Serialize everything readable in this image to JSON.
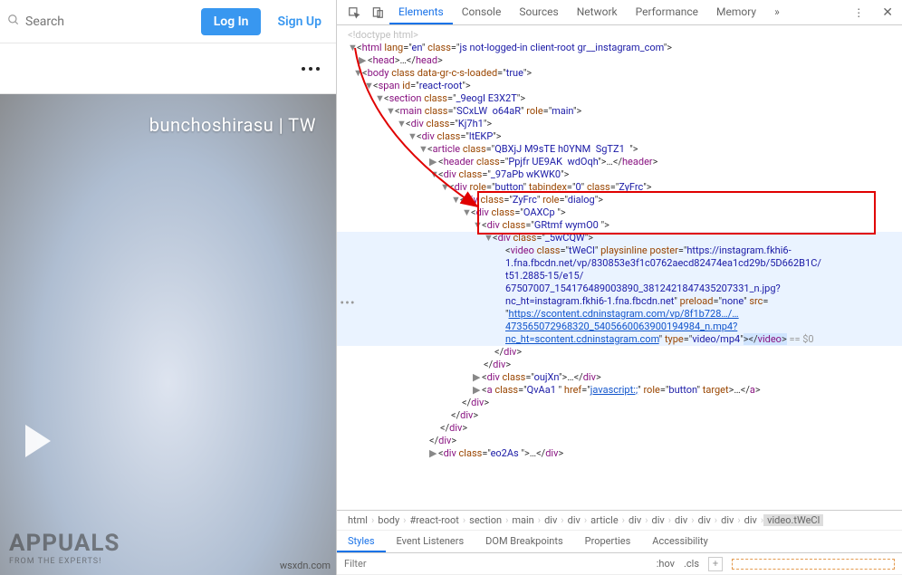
{
  "left": {
    "search_placeholder": "Search",
    "login_label": "Log In",
    "signup_label": "Sign Up",
    "video_watermark": "bunchoshirasu | TW",
    "logo_main": "APPUALS",
    "logo_sub": "FROM THE EXPERTS!",
    "site_watermark": "wsxdn.com"
  },
  "devtools": {
    "tabs": [
      "Elements",
      "Console",
      "Sources",
      "Network",
      "Performance",
      "Memory"
    ],
    "active_tab": "Elements",
    "left_gutter": "•••",
    "dom_lines": [
      {
        "ind": 12,
        "html": "<span class='doctype'>&lt;!doctype html&gt;</span>"
      },
      {
        "ind": 12,
        "arrow": "▼",
        "html": "&lt;<span class='tag'>html</span> <span class='attr-n'>lang</span>=\"<span class='attr-v'>en</span>\" <span class='attr-n'>class</span>=\"<span class='attr-v'>js not-logged-in client-root gr__instagram_com</span>\"&gt;"
      },
      {
        "ind": 24,
        "arrow": "▶",
        "html": "&lt;<span class='tag'>head</span>&gt;…&lt;/<span class='tag'>head</span>&gt;"
      },
      {
        "ind": 18,
        "arrow": "▼",
        "html": "&lt;<span class='tag'>body</span> <span class='attr-n'>class</span> <span class='attr-n'>data-gr-c-s-loaded</span>=\"<span class='attr-v'>true</span>\"&gt;"
      },
      {
        "ind": 30,
        "arrow": "▼",
        "html": "&lt;<span class='tag'>span</span> <span class='attr-n'>id</span>=\"<span class='attr-v'>react-root</span>\"&gt;"
      },
      {
        "ind": 42,
        "arrow": "▼",
        "html": "&lt;<span class='tag'>section</span> <span class='attr-n'>class</span>=\"<span class='attr-v'>_9eogI E3X2T</span>\"&gt;"
      },
      {
        "ind": 54,
        "arrow": "▼",
        "html": "&lt;<span class='tag'>main</span> <span class='attr-n'>class</span>=\"<span class='attr-v'>SCxLW&nbsp;&nbsp;o64aR</span>\" <span class='attr-n'>role</span>=\"<span class='attr-v'>main</span>\"&gt;"
      },
      {
        "ind": 66,
        "arrow": "▼",
        "html": "&lt;<span class='tag'>div</span> <span class='attr-n'>class</span>=\"<span class='attr-v'>Kj7h1</span>\"&gt;"
      },
      {
        "ind": 78,
        "arrow": "▼",
        "html": "&lt;<span class='tag'>div</span> <span class='attr-n'>class</span>=\"<span class='attr-v'>ltEKP</span>\"&gt;"
      },
      {
        "ind": 90,
        "arrow": "▼",
        "html": "&lt;<span class='tag'>article</span> <span class='attr-n'>class</span>=\"<span class='attr-v'>QBXjJ M9sTE h0YNM&nbsp;&nbsp;SgTZ1&nbsp;&nbsp;</span>\"&gt;"
      },
      {
        "ind": 102,
        "arrow": "▶",
        "html": "&lt;<span class='tag'>header</span> <span class='attr-n'>class</span>=\"<span class='attr-v'>Ppjfr UE9AK&nbsp;&nbsp;wdOqh</span>\"&gt;…&lt;/<span class='tag'>header</span>&gt;"
      },
      {
        "ind": 102,
        "arrow": "▼",
        "html": "&lt;<span class='tag'>div</span> <span class='attr-n'>class</span>=\"<span class='attr-v'>_97aPb wKWK0</span>\"&gt;"
      },
      {
        "ind": 114,
        "arrow": "▼",
        "html": "&lt;<span class='tag'>div</span> <span class='attr-n'>role</span>=\"<span class='attr-v'>button</span>\" <span class='attr-n'>tabindex</span>=\"<span class='attr-v'>0</span>\" <span class='attr-n'>class</span>=\"<span class='attr-v'>ZyFrc</span>\"&gt;"
      },
      {
        "ind": 126,
        "arrow": "▼",
        "html": "&lt;<span class='tag'>div</span> <span class='attr-n'>class</span>=\"<span class='attr-v'>ZyFrc</span>\" <span class='attr-n'>role</span>=\"<span class='attr-v'>dialog</span>\"&gt;"
      },
      {
        "ind": 138,
        "arrow": "▼",
        "html": "&lt;<span class='tag'>div</span> <span class='attr-n'>class</span>=\"<span class='attr-v'>OAXCp </span>\"&gt;"
      },
      {
        "ind": 150,
        "arrow": "▼",
        "html": "&lt;<span class='tag'>div</span> <span class='attr-n'>class</span>=\"<span class='attr-v'>GRtmf wymO0 </span>\"&gt;"
      },
      {
        "ind": 162,
        "arrow": "▼",
        "html": "&lt;<span class='tag'>div</span> <span class='attr-n'>class</span>=\"<span class='attr-v'>_5wCQW</span>\"&gt;",
        "sel": true
      },
      {
        "ind": 186,
        "html": "&lt;<span class='tag'>video</span> <span class='attr-n'>class</span>=\"<span class='attr-v'>tWeCl</span>\" <span class='attr-n'>playsinline</span> <span class='attr-n'>poster</span>=\"<span class='attr-v'>https://instagram.fkhi6-</span>",
        "sel": true
      },
      {
        "ind": 186,
        "html": "<span class='attr-v'>1.fna.fbcdn.net/vp/830853e3f1c0762aecd82474ea1cd29b/5D662B1C/</span>",
        "sel": true
      },
      {
        "ind": 186,
        "html": "<span class='attr-v'>t51.2885-15/e15/</span>",
        "sel": true
      },
      {
        "ind": 186,
        "html": "<span class='attr-v'>67507007_154176489003890_3812421847435207331_n.jpg?</span>",
        "sel": true
      },
      {
        "ind": 186,
        "html": "<span class='attr-v'>nc_ht=instagram.fkhi6-1.fna.fbcdn.net</span>\" <span class='attr-n'>preload</span>=\"<span class='attr-v'>none</span>\" <span class='attr-n'>src</span>=",
        "sel": true
      },
      {
        "ind": 186,
        "html": "\"<a class='url-link'>https://scontent.cdninstagram.com/vp/8f1b728…/…</a>",
        "sel": true
      },
      {
        "ind": 186,
        "html": "<a class='url-link'>473565072968320_5405660063900194984_n.mp4?</a>",
        "sel": true
      },
      {
        "ind": 186,
        "html": "<a class='url-link'>nc_ht=scontent.cdninstagram.com</a>\" <span class='attr-n'>type</span>=\"<span class='attr-v'>video/mp4</span>\"<span style='background:#d0e4ff'>&gt;&lt;/<span class='tag'>video</span>&gt;</span> <span class='eqline'>== $0</span>",
        "sel": true
      },
      {
        "ind": 174,
        "html": "&lt;/<span class='tag'>div</span>&gt;"
      },
      {
        "ind": 162,
        "html": "&lt;/<span class='tag'>div</span>&gt;"
      },
      {
        "ind": 150,
        "arrow": "▶",
        "html": "&lt;<span class='tag'>div</span> <span class='attr-n'>class</span>=\"<span class='attr-v'>oujXn</span>\"&gt;…&lt;/<span class='tag'>div</span>&gt;"
      },
      {
        "ind": 150,
        "arrow": "▶",
        "html": "&lt;<span class='tag'>a</span> <span class='attr-n'>class</span>=\"<span class='attr-v'>QvAa1 </span>\" <span class='attr-n'>href</span>=\"<a class='url-link'>javascript:;</a>\" <span class='attr-n'>role</span>=\"<span class='attr-v'>button</span>\" <span class='attr-n'>target</span>&gt;…&lt;/<span class='tag'>a</span>&gt;"
      },
      {
        "ind": 138,
        "html": "&lt;/<span class='tag'>div</span>&gt;"
      },
      {
        "ind": 126,
        "html": "&lt;/<span class='tag'>div</span>&gt;"
      },
      {
        "ind": 114,
        "html": "&lt;/<span class='tag'>div</span>&gt;"
      },
      {
        "ind": 102,
        "html": "&lt;/<span class='tag'>div</span>&gt;"
      },
      {
        "ind": 102,
        "arrow": "▶",
        "html": "&lt;<span class='tag'>div</span> <span class='attr-n'>class</span>=\"<span class='attr-v'>eo2As </span>\"&gt;…&lt;/<span class='tag'>div</span>&gt;"
      }
    ],
    "breadcrumb": [
      "html",
      "body",
      "#react-root",
      "section",
      "main",
      "div",
      "div",
      "article",
      "div",
      "div",
      "div",
      "div",
      "div",
      "div",
      "video.tWeCl"
    ],
    "styles_tabs": [
      "Styles",
      "Event Listeners",
      "DOM Breakpoints",
      "Properties",
      "Accessibility"
    ],
    "active_styles_tab": "Styles",
    "filter_placeholder": "Filter",
    "hov_label": ":hov",
    "cls_label": ".cls"
  }
}
